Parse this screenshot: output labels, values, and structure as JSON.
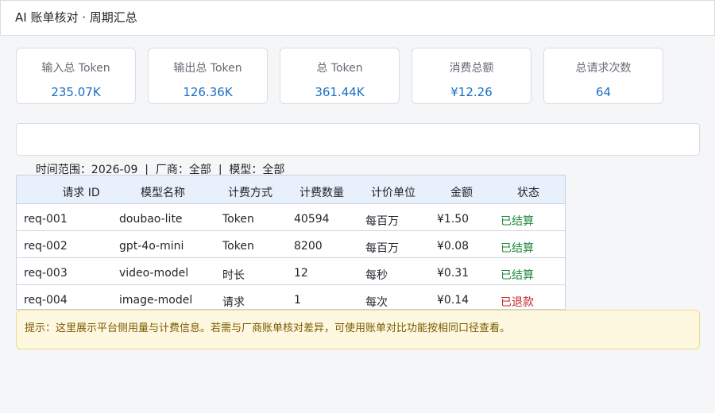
{
  "header": {
    "title": "AI 账单核对 · 周期汇总"
  },
  "cards": [
    {
      "label": "输入总 Token",
      "value": "235.07K"
    },
    {
      "label": "输出总 Token",
      "value": "126.36K"
    },
    {
      "label": "总 Token",
      "value": "361.44K"
    },
    {
      "label": "消费总额",
      "value": "¥12.26"
    },
    {
      "label": "总请求次数",
      "value": "64"
    }
  ],
  "filter": {
    "text": "时间范围：2026-09  |  厂商：全部  |  模型：全部"
  },
  "table": {
    "columns": [
      "请求 ID",
      "模型名称",
      "计费方式",
      "计费数量",
      "计价单位",
      "金额",
      "状态"
    ],
    "rows": [
      [
        "req-001",
        "doubao-lite",
        "Token",
        "40594",
        "每百万",
        "¥1.50",
        "已结算"
      ],
      [
        "req-002",
        "gpt-4o-mini",
        "Token",
        "8200",
        "每百万",
        "¥0.08",
        "已结算"
      ],
      [
        "req-003",
        "video-model",
        "时长",
        "12",
        "每秒",
        "¥0.31",
        "已结算"
      ],
      [
        "req-004",
        "image-model",
        "请求",
        "1",
        "每次",
        "¥0.14",
        "已退款"
      ]
    ]
  },
  "notice": {
    "text": "提示：这里展示平台侧用量与计费信息。若需与厂商账单核对差异，可使用账单对比功能按相同口径查看。"
  },
  "colors": {
    "accent": "#1a6fc4",
    "settled": "#1f8a3b",
    "refunded": "#c62828",
    "notice_bg": "#fff8e1"
  }
}
